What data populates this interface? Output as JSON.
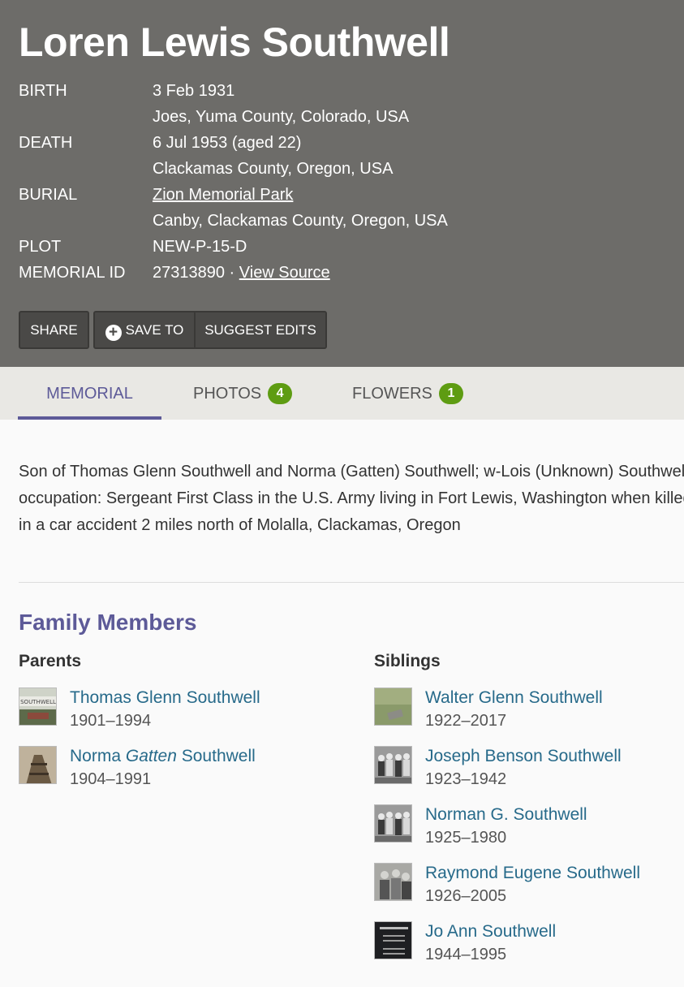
{
  "memorial": {
    "name": "Loren Lewis Southwell",
    "facts": {
      "birth_label": "BIRTH",
      "birth_date": "3 Feb 1931",
      "birth_place": "Joes, Yuma County, Colorado, USA",
      "death_label": "DEATH",
      "death_date": "6 Jul 1953 (aged 22)",
      "death_place": "Clackamas County, Oregon, USA",
      "burial_label": "BURIAL",
      "burial_cemetery": "Zion Memorial Park",
      "burial_place": "Canby, Clackamas County, Oregon, USA",
      "plot_label": "PLOT",
      "plot": "NEW-P-15-D",
      "memorial_id_label": "MEMORIAL ID",
      "memorial_id": "27313890 · ",
      "view_source": "View Source"
    }
  },
  "actions": {
    "share": "SHARE",
    "save_to": "SAVE TO",
    "suggest_edits": "SUGGEST EDITS"
  },
  "tabs": {
    "memorial": "MEMORIAL",
    "photos": "PHOTOS",
    "photos_count": "4",
    "flowers": "FLOWERS",
    "flowers_count": "1"
  },
  "bio": {
    "line1": "Son of Thomas Glenn Southwell and Norma (Gatten) Southwell; w-Lois (Unknown) Southwell;",
    "line2": "occupation: Sergeant First Class in the U.S. Army living in Fort Lewis, Washington when killed",
    "line3": "in a car accident 2 miles north of Molalla, Clackamas, Oregon"
  },
  "family": {
    "title": "Family Members",
    "parents_heading": "Parents",
    "siblings_heading": "Siblings",
    "parents": [
      {
        "name": "Thomas Glenn Southwell",
        "dates": "1901–1994"
      },
      {
        "name_first": "Norma ",
        "name_maiden": "Gatten",
        "name_last": " Southwell",
        "dates": "1904–1991"
      }
    ],
    "siblings": [
      {
        "name": "Walter Glenn Southwell",
        "dates": "1922–2017"
      },
      {
        "name": "Joseph Benson Southwell",
        "dates": "1923–1942"
      },
      {
        "name": "Norman G. Southwell",
        "dates": "1925–1980"
      },
      {
        "name": "Raymond Eugene Southwell",
        "dates": "1926–2005"
      },
      {
        "name": "Jo Ann Southwell",
        "dates": "1944–1995"
      }
    ]
  },
  "colors": {
    "header_bg": "#6d6c69",
    "accent": "#5d5a98",
    "badge": "#5e9c12",
    "link": "#276a8a"
  }
}
